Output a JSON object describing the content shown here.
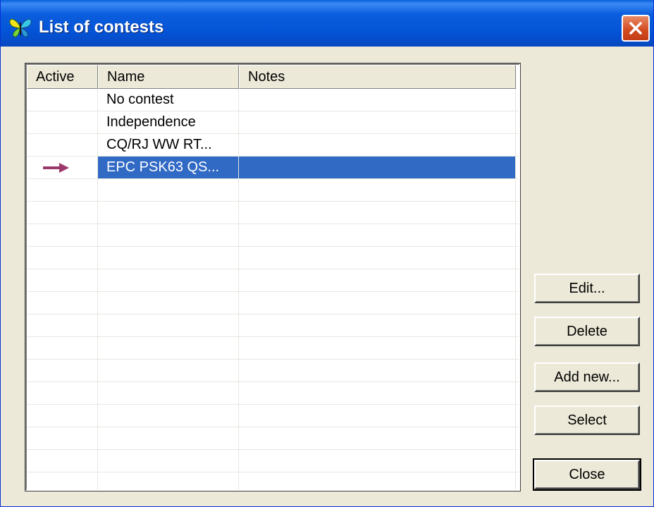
{
  "window": {
    "title": "List of contests",
    "close_label": "✕"
  },
  "table": {
    "columns": [
      "Active",
      "Name",
      "Notes"
    ],
    "rows": [
      {
        "active": false,
        "name": "No contest",
        "notes": ""
      },
      {
        "active": false,
        "name": "Independence",
        "notes": ""
      },
      {
        "active": false,
        "name": "CQ/RJ WW RT...",
        "notes": ""
      },
      {
        "active": true,
        "name": "EPC PSK63 QS...",
        "notes": "",
        "selected": true
      }
    ],
    "empty_row_count": 14
  },
  "buttons": {
    "edit": "Edit...",
    "delete": "Delete",
    "add_new": "Add new...",
    "select": "Select",
    "close": "Close"
  },
  "colors": {
    "selection": "#316ac5",
    "active_arrow": "#9b3a6a",
    "titlebar": "#0453d6"
  },
  "icons": {
    "app": "butterfly-icon",
    "active_marker": "arrow-right-icon"
  }
}
